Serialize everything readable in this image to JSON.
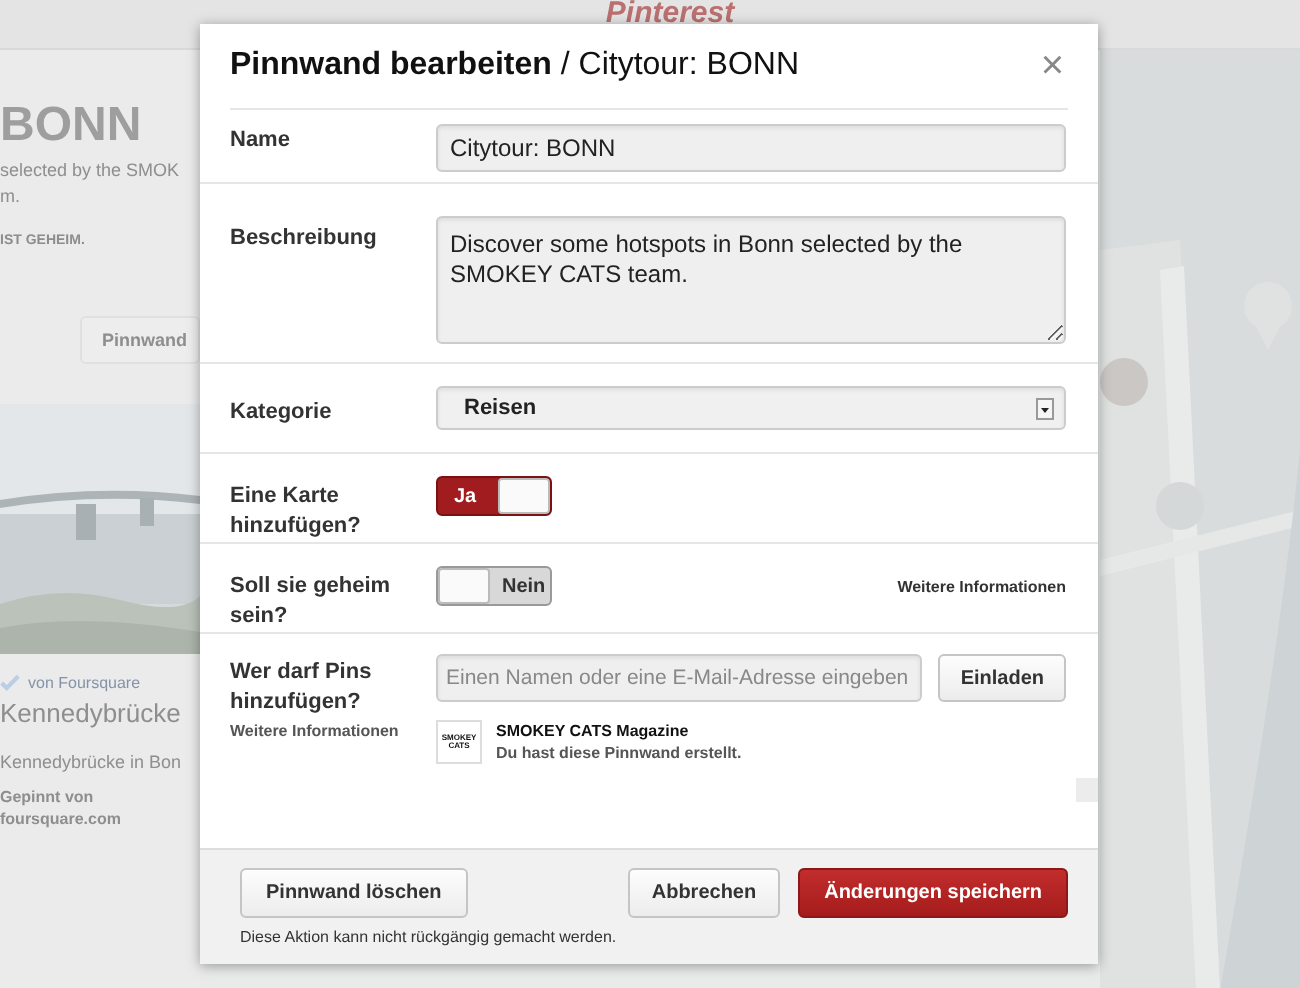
{
  "background": {
    "logo": "Pinterest",
    "board_title": "BONN",
    "board_description": [
      "selected by the SMOK",
      "m."
    ],
    "secret_note": "IST GEHEIM.",
    "edit_button": "Pinnwand",
    "pin": {
      "source": "von Foursquare",
      "title": "Kennedybrücke",
      "description": "Kennedybrücke in Bon",
      "pinned_by_label": "Gepinnt von",
      "pinned_by": "foursquare.com"
    }
  },
  "dialog": {
    "title": "**Pinnwand bearbeiten** / Citytour: BONN",
    "close": "×",
    "fields": [
      {
        "kind": "text",
        "label": "Name",
        "value": "Citytour: BONN"
      },
      {
        "kind": "textarea",
        "label": "Beschreibung",
        "value": "Discover some hotspots in Bonn selected by the SMOKEY CATS team."
      },
      {
        "kind": "select",
        "label": "Kategorie",
        "value": "Reisen"
      },
      {
        "kind": "toggle",
        "label": "Eine Karte hinzufügen?",
        "on": true,
        "toggle_label": "Ja"
      },
      {
        "kind": "toggle",
        "label": "Soll sie geheim sein?",
        "on": false,
        "toggle_label": "Nein",
        "link": "Weitere Informationen"
      },
      {
        "kind": "collaborators",
        "label": "Wer darf Pins hinzufügen?",
        "sublabel": "Weitere Informationen",
        "placeholder": "Einen Namen oder eine E-Mail-Adresse eingeben",
        "button": "Einladen",
        "collaborators": [
          {
            "avatar_text": "SMOKEY CATS",
            "name": "SMOKEY CATS Magazine",
            "note": "Du hast diese Pinnwand erstellt."
          }
        ]
      }
    ],
    "footer": {
      "delete_button": "Pinnwand löschen",
      "delete_note": "Diese Aktion kann nicht rückgängig gemacht werden.",
      "cancel_button": "Abbrechen",
      "save_button": "Änderungen speichern"
    }
  }
}
